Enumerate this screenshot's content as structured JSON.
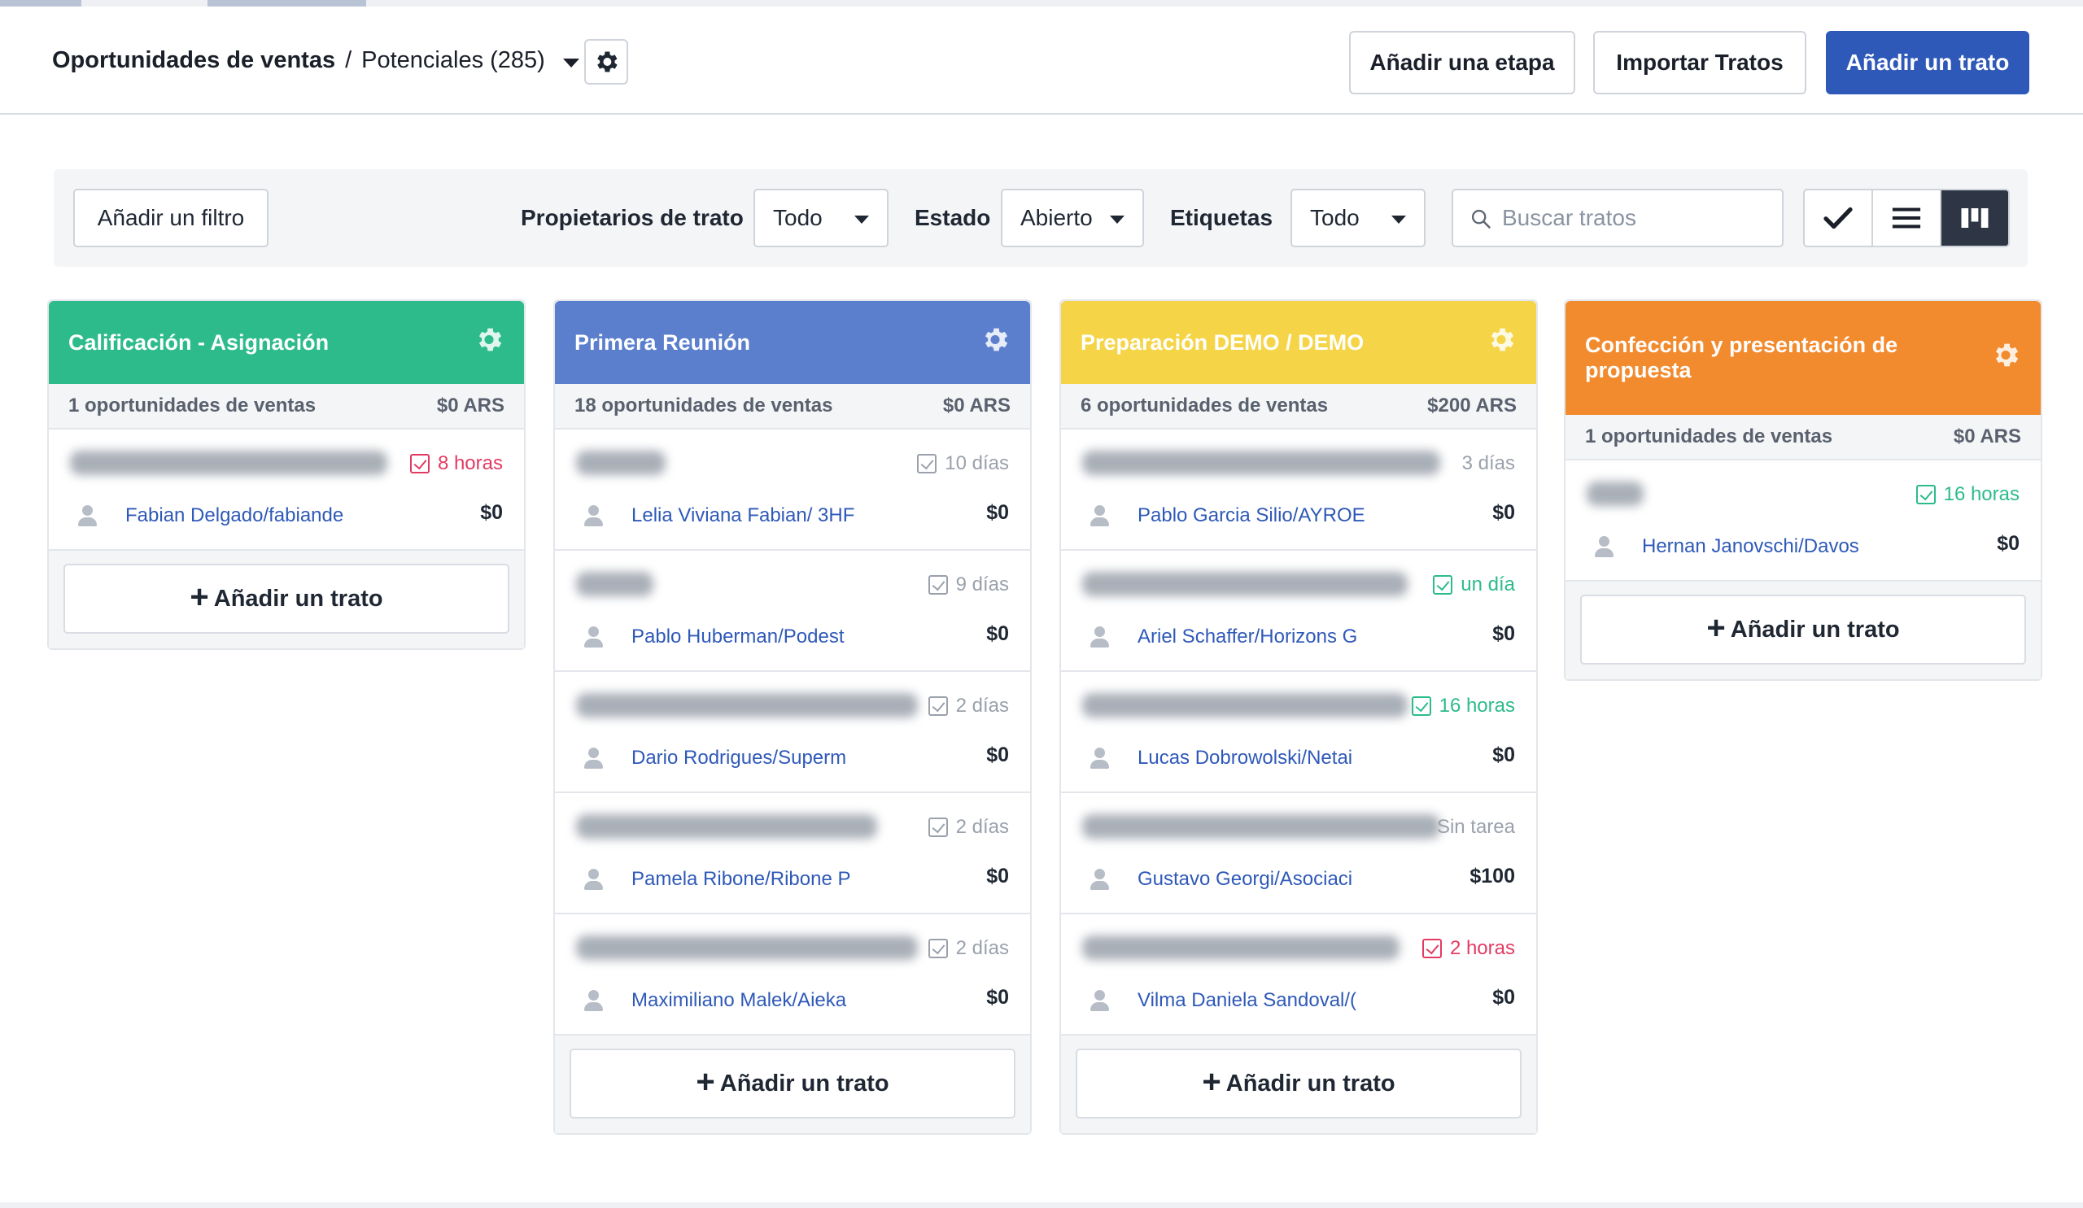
{
  "header": {
    "breadcrumb_main": "Oportunidades de ventas",
    "breadcrumb_sep": "/",
    "breadcrumb_sub": "Potenciales (285)",
    "add_stage": "Añadir una etapa",
    "import_deals": "Importar Tratos",
    "add_deal": "Añadir un trato"
  },
  "filters": {
    "add_filter": "Añadir un filtro",
    "owners_label": "Propietarios de trato",
    "owners_value": "Todo",
    "status_label": "Estado",
    "status_value": "Abierto",
    "tags_label": "Etiquetas",
    "tags_value": "Todo",
    "search_placeholder": "Buscar tratos"
  },
  "colors": {
    "primary": "#2f59b8",
    "stage1": "#2dbb8c",
    "stage2": "#5b7fcc",
    "stage3": "#f5d547",
    "stage4": "#f28a2e",
    "overdue": "#e23b62",
    "due_ok": "#2dbb8c",
    "neutral": "#9aa1ab"
  },
  "add_deal_label": "Añadir un trato",
  "columns": [
    {
      "title": "Calificación - Asignación",
      "count": "1 oportunidades de ventas",
      "total": "$0 ARS",
      "cards": [
        {
          "task": "8 horas",
          "owner": "Fabian Delgado/fabiande",
          "amount": "$0"
        }
      ]
    },
    {
      "title": "Primera Reunión",
      "count": "18 oportunidades de ventas",
      "total": "$0 ARS",
      "cards": [
        {
          "task": "10 días",
          "owner": "Lelia Viviana Fabian/ 3HF",
          "amount": "$0"
        },
        {
          "task": "9 días",
          "owner": "Pablo Huberman/Podest",
          "amount": "$0"
        },
        {
          "task": "2 días",
          "owner": "Dario Rodrigues/Superm",
          "amount": "$0"
        },
        {
          "task": "2 días",
          "owner": "Pamela Ribone/Ribone P",
          "amount": "$0"
        },
        {
          "task": "2 días",
          "owner": "Maximiliano Malek/Aieka",
          "amount": "$0"
        }
      ]
    },
    {
      "title": "Preparación DEMO / DEMO",
      "count": "6 oportunidades de ventas",
      "total": "$200 ARS",
      "cards": [
        {
          "task": "3 días",
          "owner": "Pablo Garcia Silio/AYROE",
          "amount": "$0"
        },
        {
          "task": "un día",
          "owner": "Ariel Schaffer/Horizons G",
          "amount": "$0"
        },
        {
          "task": "16 horas",
          "owner": "Lucas Dobrowolski/Netai",
          "amount": "$0"
        },
        {
          "task": "Sin tarea",
          "owner": "Gustavo Georgi/Asociaci",
          "amount": "$100"
        },
        {
          "task": "2 horas",
          "owner": "Vilma Daniela Sandoval/(",
          "amount": "$0"
        }
      ]
    },
    {
      "title": "Confección y presentación de propuesta",
      "count": "1 oportunidades de ventas",
      "total": "$0 ARS",
      "cards": [
        {
          "task": "16 horas",
          "owner": "Hernan Janovschi/Davos",
          "amount": "$0"
        }
      ]
    }
  ]
}
